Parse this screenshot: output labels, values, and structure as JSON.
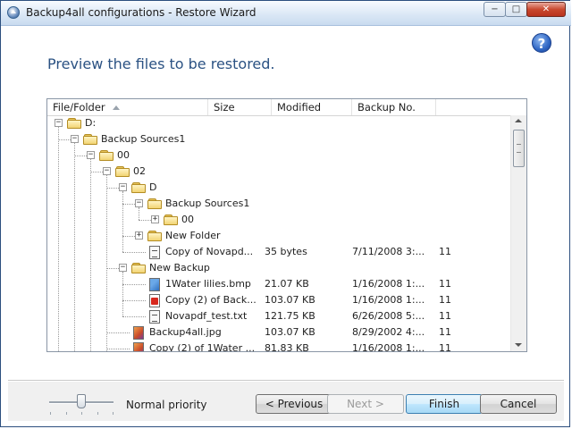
{
  "window": {
    "title": "Backup4all configurations - Restore Wizard",
    "min_label": "−",
    "max_label": "□",
    "close_label": "✕"
  },
  "help": {
    "label": "?"
  },
  "heading": "Preview the files to be restored.",
  "table": {
    "columns": [
      "File/Folder",
      "Size",
      "Modified",
      "Backup No."
    ],
    "sort_column": "File/Folder",
    "sort_direction": "ascending"
  },
  "tree": [
    {
      "name": "D:",
      "type": "folder",
      "level": 0,
      "expander": "⊟",
      "size": "",
      "modified": "",
      "backup": ""
    },
    {
      "name": "Backup Sources1",
      "type": "folder",
      "level": 1,
      "expander": "⊟",
      "size": "",
      "modified": "",
      "backup": ""
    },
    {
      "name": "00",
      "type": "folder",
      "level": 2,
      "expander": "⊟",
      "size": "",
      "modified": "",
      "backup": ""
    },
    {
      "name": "02",
      "type": "folder",
      "level": 3,
      "expander": "⊟",
      "size": "",
      "modified": "",
      "backup": ""
    },
    {
      "name": "D",
      "type": "folder",
      "level": 4,
      "expander": "⊟",
      "size": "",
      "modified": "",
      "backup": ""
    },
    {
      "name": "Backup Sources1",
      "type": "folder",
      "level": 5,
      "expander": "⊟",
      "size": "",
      "modified": "",
      "backup": ""
    },
    {
      "name": "00",
      "type": "folder",
      "level": 6,
      "expander": "⊞",
      "size": "",
      "modified": "",
      "backup": ""
    },
    {
      "name": "New Folder",
      "type": "folder",
      "level": 5,
      "expander": "⊞",
      "size": "",
      "modified": "",
      "backup": ""
    },
    {
      "name": "Copy of Novapd...",
      "type": "txt",
      "level": 5,
      "expander": "",
      "size": "35 bytes",
      "modified": "7/11/2008 3:...",
      "backup": "11"
    },
    {
      "name": "New Backup",
      "type": "folder",
      "level": 4,
      "expander": "⊟",
      "size": "",
      "modified": "",
      "backup": ""
    },
    {
      "name": "1Water lilies.bmp",
      "type": "bmp",
      "level": 5,
      "expander": "",
      "size": "21.07 KB",
      "modified": "1/16/2008 1:...",
      "backup": "11"
    },
    {
      "name": "Copy (2) of Back...",
      "type": "pdf",
      "level": 5,
      "expander": "",
      "size": "103.07 KB",
      "modified": "1/16/2008 1:...",
      "backup": "11"
    },
    {
      "name": "Novapdf_test.txt",
      "type": "txt",
      "level": 5,
      "expander": "",
      "size": "121.75 KB",
      "modified": "6/26/2008 5:...",
      "backup": "11"
    },
    {
      "name": "Backup4all.jpg",
      "type": "jpg",
      "level": 4,
      "expander": "",
      "size": "103.07 KB",
      "modified": "8/29/2002 4:...",
      "backup": "11"
    },
    {
      "name": "Copy (2) of 1Water ...",
      "type": "jpg",
      "level": 4,
      "expander": "",
      "size": "81.83 KB",
      "modified": "1/16/2008 1:...",
      "backup": "11"
    }
  ],
  "footer": {
    "priority_label": "Normal priority",
    "priority_level": 0.5,
    "previous_label": "< Previous",
    "next_label": "Next >",
    "finish_label": "Finish",
    "cancel_label": "Cancel"
  }
}
